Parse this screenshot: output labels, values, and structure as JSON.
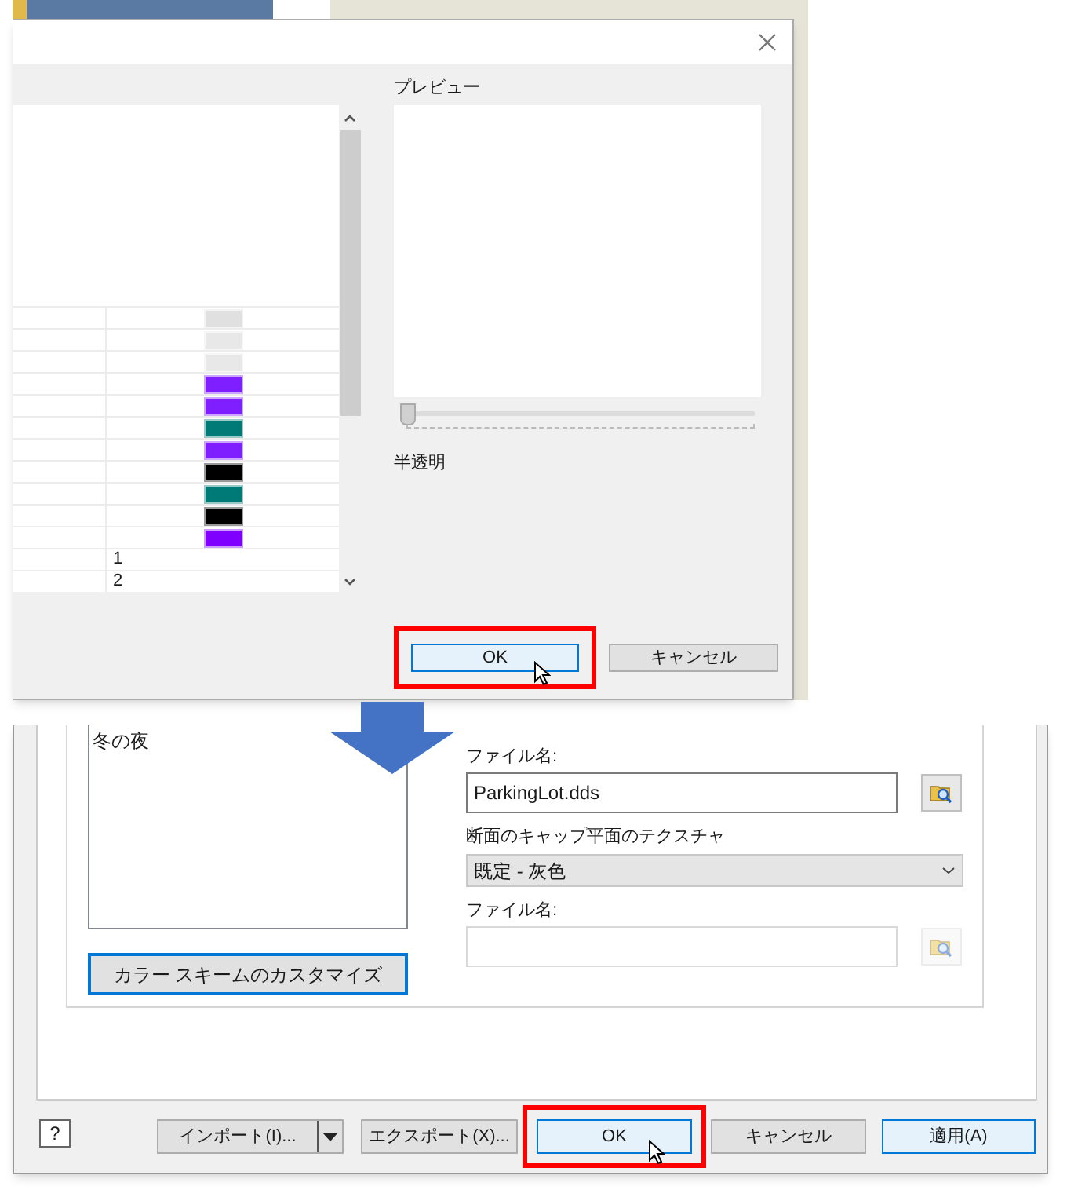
{
  "preview_dialog": {
    "table": {
      "rows": [
        {
          "kind": "swatch",
          "color": "#e0e0e0"
        },
        {
          "kind": "swatch",
          "color": "#e8e8e8"
        },
        {
          "kind": "swatch",
          "color": "#e8e8e8"
        },
        {
          "kind": "swatch",
          "color": "#7f1fff"
        },
        {
          "kind": "swatch",
          "color": "#7f1fff"
        },
        {
          "kind": "swatch",
          "color": "#007a76"
        },
        {
          "kind": "swatch",
          "color": "#7f1fff"
        },
        {
          "kind": "swatch",
          "color": "#000000"
        },
        {
          "kind": "swatch",
          "color": "#007a76"
        },
        {
          "kind": "swatch",
          "color": "#000000"
        },
        {
          "kind": "swatch",
          "color": "#7f00ff"
        },
        {
          "kind": "text",
          "column_2": "1"
        },
        {
          "kind": "text",
          "column_2": "2"
        }
      ]
    },
    "preview": {
      "label": "プレビュー"
    },
    "opacity_slider": {
      "label": "半透明",
      "level": 0
    },
    "buttons": [
      {
        "label": "OK",
        "focused": true,
        "highlighted": true
      },
      {
        "label": "キャンセル",
        "focused": false,
        "highlighted": false
      }
    ]
  },
  "settings_dialog": {
    "scheme_list": {
      "items": [
        "冬の夜"
      ]
    },
    "customize_button": "カラー スキームのカスタマイズ",
    "fields": [
      {
        "kind": "text",
        "label": "ファイル名:",
        "value": "ParkingLot.dds",
        "disabled": false
      },
      {
        "kind": "select",
        "label": "断面のキャップ平面のテクスチャ",
        "value": "既定 - 灰色"
      },
      {
        "kind": "text",
        "label": "ファイル名:",
        "disabled": true
      }
    ],
    "help_button": "?",
    "buttons": [
      {
        "kind": "split",
        "label": "インポート(I)...",
        "focused": false,
        "highlighted": false
      },
      {
        "kind": "plain",
        "label": "エクスポート(X)...",
        "focused": false,
        "highlighted": false
      },
      {
        "kind": "plain",
        "label": "OK",
        "focused": true,
        "highlighted": true
      },
      {
        "kind": "plain",
        "label": "キャンセル",
        "focused": false,
        "highlighted": false
      },
      {
        "kind": "plain",
        "label": "適用(A)",
        "focused": true,
        "highlighted": false
      }
    ]
  }
}
